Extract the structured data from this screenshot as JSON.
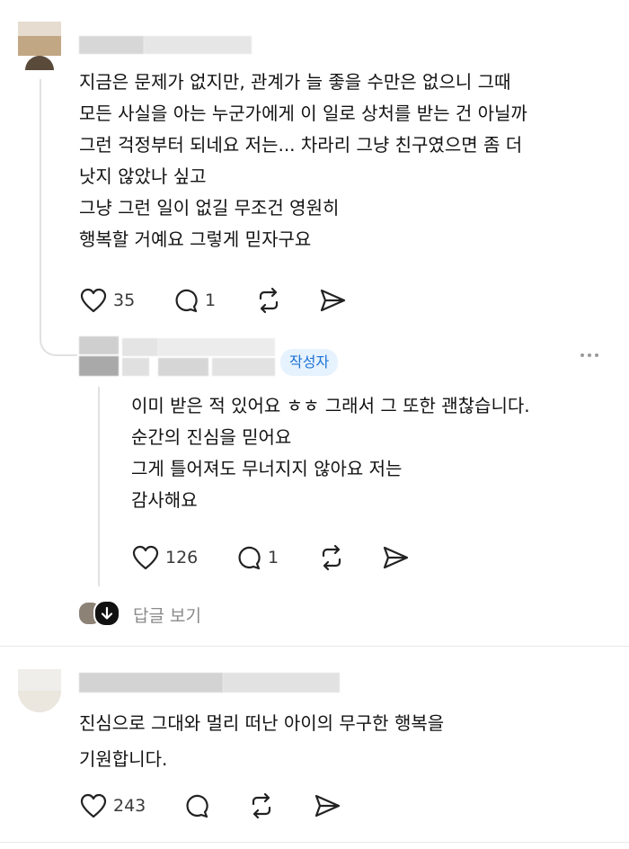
{
  "comments": [
    {
      "lines": [
        "지금은 문제가 없지만, 관계가 늘 좋을 수만은 없으니 그때",
        "모든 사실을 아는 누군가에게 이 일로 상처를 받는 건 아닐까",
        "그런 걱정부터 되네요 저는... 차라리 그냥 친구였으면 좀 더",
        "낫지 않았나 싶고",
        "그냥 그런 일이 없길 무조건 영원히",
        "행복할 거예요 그렇게 믿자구요"
      ],
      "likes": "35",
      "replies": "1"
    },
    {
      "badge": "작성자",
      "lines": [
        "이미 받은 적 있어요 ㅎㅎ 그래서 그 또한 괜찮습니다.",
        "순간의 진심을 믿어요",
        "그게 틀어져도 무너지지 않아요 저는",
        "감사해요"
      ],
      "likes": "126",
      "replies": "1"
    },
    {
      "lines": [
        "진심으로 그대와 멀리 떠난 아이의 무구한 행복을",
        "기원합니다."
      ],
      "likes": "243",
      "replies": ""
    }
  ],
  "view_replies_label": "답글 보기",
  "icons": {
    "like": "heart-icon",
    "reply": "comment-bubble-icon",
    "repost": "repost-icon",
    "share": "send-icon",
    "more": "more-dots-icon",
    "expand": "arrow-down-icon"
  },
  "colors": {
    "badge_bg": "#e6f2fd",
    "badge_text": "#1d72d6",
    "muted_text": "#8a8a8a",
    "thread_line": "#e1e1e1"
  }
}
